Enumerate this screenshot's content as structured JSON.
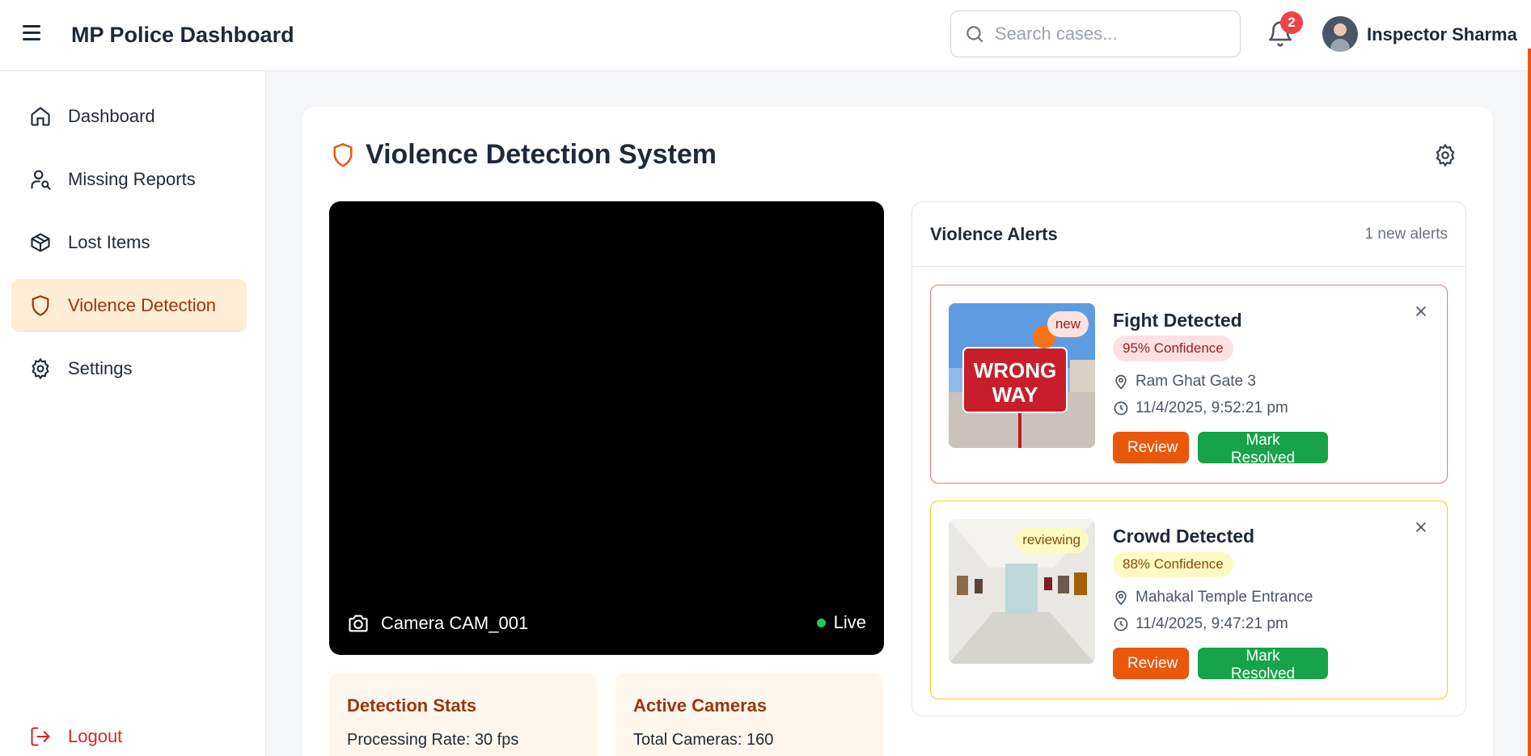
{
  "header": {
    "app_title": "MP Police Dashboard",
    "search_placeholder": "Search cases...",
    "notification_count": "2",
    "user_name": "Inspector Sharma"
  },
  "sidebar": {
    "items": [
      {
        "label": "Dashboard",
        "icon": "home-icon"
      },
      {
        "label": "Missing Reports",
        "icon": "user-search-icon"
      },
      {
        "label": "Lost Items",
        "icon": "package-icon"
      },
      {
        "label": "Violence Detection",
        "icon": "shield-icon",
        "active": true
      },
      {
        "label": "Settings",
        "icon": "gear-icon"
      }
    ],
    "logout_label": "Logout"
  },
  "page": {
    "title": "Violence Detection System"
  },
  "video": {
    "camera_label": "Camera CAM_001",
    "live_label": "Live"
  },
  "stats": {
    "detection": {
      "title": "Detection Stats",
      "line": "Processing Rate: 30 fps"
    },
    "cameras": {
      "title": "Active Cameras",
      "line": "Total Cameras: 160"
    }
  },
  "alerts": {
    "title": "Violence Alerts",
    "count_text": "1 new alerts",
    "items": [
      {
        "title": "Fight Detected",
        "confidence": "95% Confidence",
        "location": "Ram Ghat Gate 3",
        "time": "11/4/2025, 9:52:21 pm",
        "status": "new",
        "review_label": "Review",
        "resolve_label": "Mark Resolved"
      },
      {
        "title": "Crowd Detected",
        "confidence": "88% Confidence",
        "location": "Mahakal Temple Entrance",
        "time": "11/4/2025, 9:47:21 pm",
        "status": "reviewing",
        "review_label": "Review",
        "resolve_label": "Mark Resolved"
      }
    ]
  },
  "colors": {
    "accent": "#ea580c",
    "active_bg": "#ffedd5",
    "success": "#16a34a",
    "danger": "#ef4444"
  }
}
